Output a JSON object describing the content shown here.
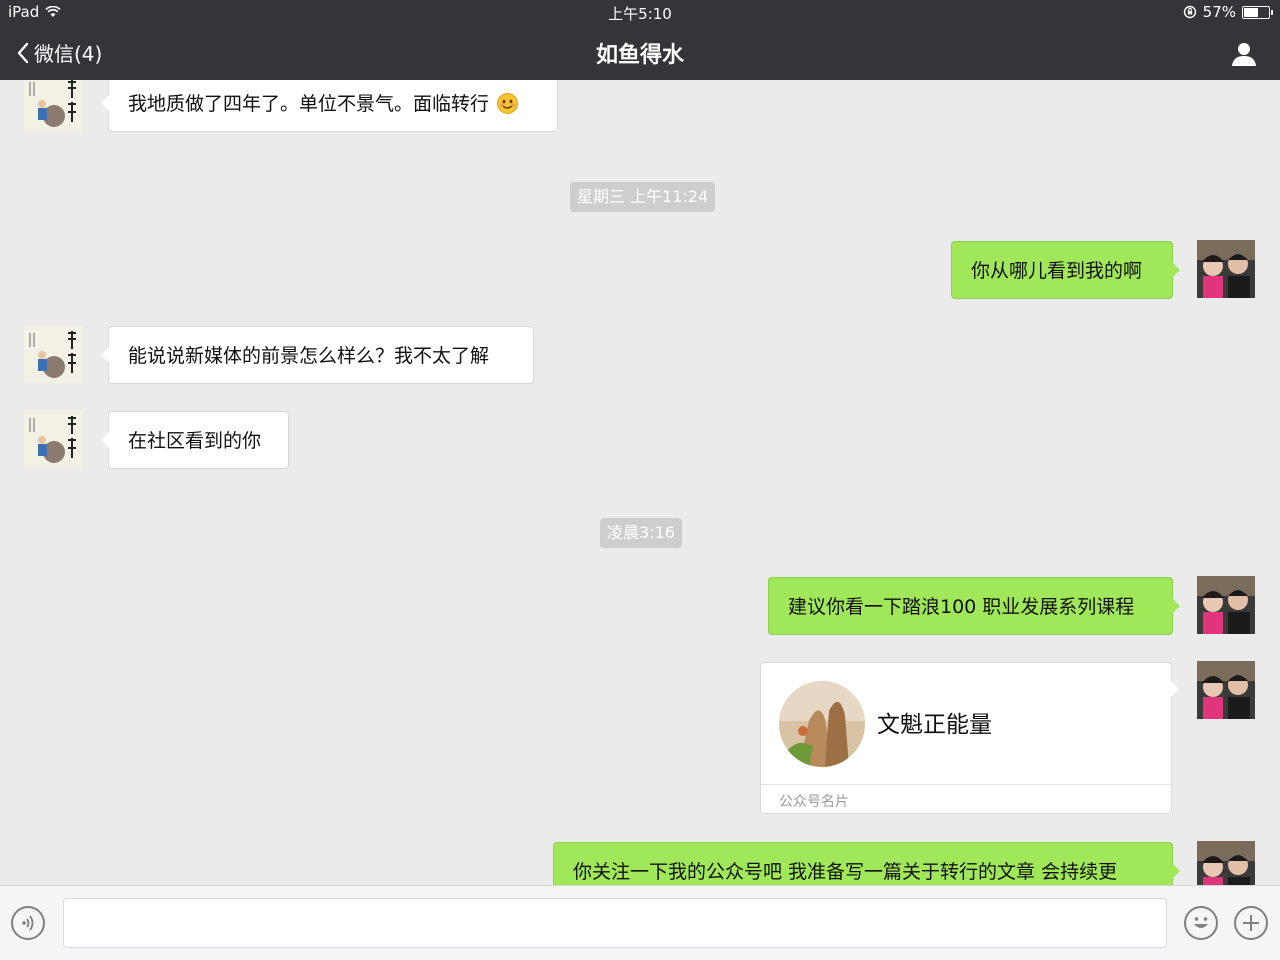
{
  "status_bar": {
    "device": "iPad",
    "time": "上午5:10",
    "battery_percent": "57%",
    "battery_level": 0.57
  },
  "nav": {
    "back_label": "微信(4)",
    "title": "如鱼得水",
    "profile_icon": "person-icon"
  },
  "messages": [
    {
      "side": "left",
      "text": "我地质做了四年了。单位不景气。面临转行",
      "emoji": "smiling-face-icon"
    },
    {
      "type": "timestamp",
      "text": "星期三 上午11:24"
    },
    {
      "side": "right",
      "text": "你从哪儿看到我的啊"
    },
    {
      "side": "left",
      "text": "能说说新媒体的前景怎么样么？我不太了解"
    },
    {
      "side": "left",
      "text": "在社区看到的你"
    },
    {
      "type": "timestamp",
      "text": "凌晨3:16"
    },
    {
      "side": "right",
      "text": "建议你看一下踏浪100 职业发展系列课程"
    },
    {
      "side": "right",
      "type": "card",
      "name": "文魁正能量",
      "label": "公众号名片"
    },
    {
      "side": "right",
      "text": "你关注一下我的公众号吧 我准备写一篇关于转行的文章 会持续更"
    }
  ],
  "input_bar": {
    "voice_icon": "voice-icon",
    "emoji_icon": "emoji-icon",
    "plus_icon": "plus-icon",
    "placeholder": ""
  },
  "colors": {
    "header_bg": "#353539",
    "chat_bg": "#ebebeb",
    "sent_bubble": "#a0e75a",
    "received_bubble": "#ffffff",
    "timestamp_bg": "#cecece"
  }
}
